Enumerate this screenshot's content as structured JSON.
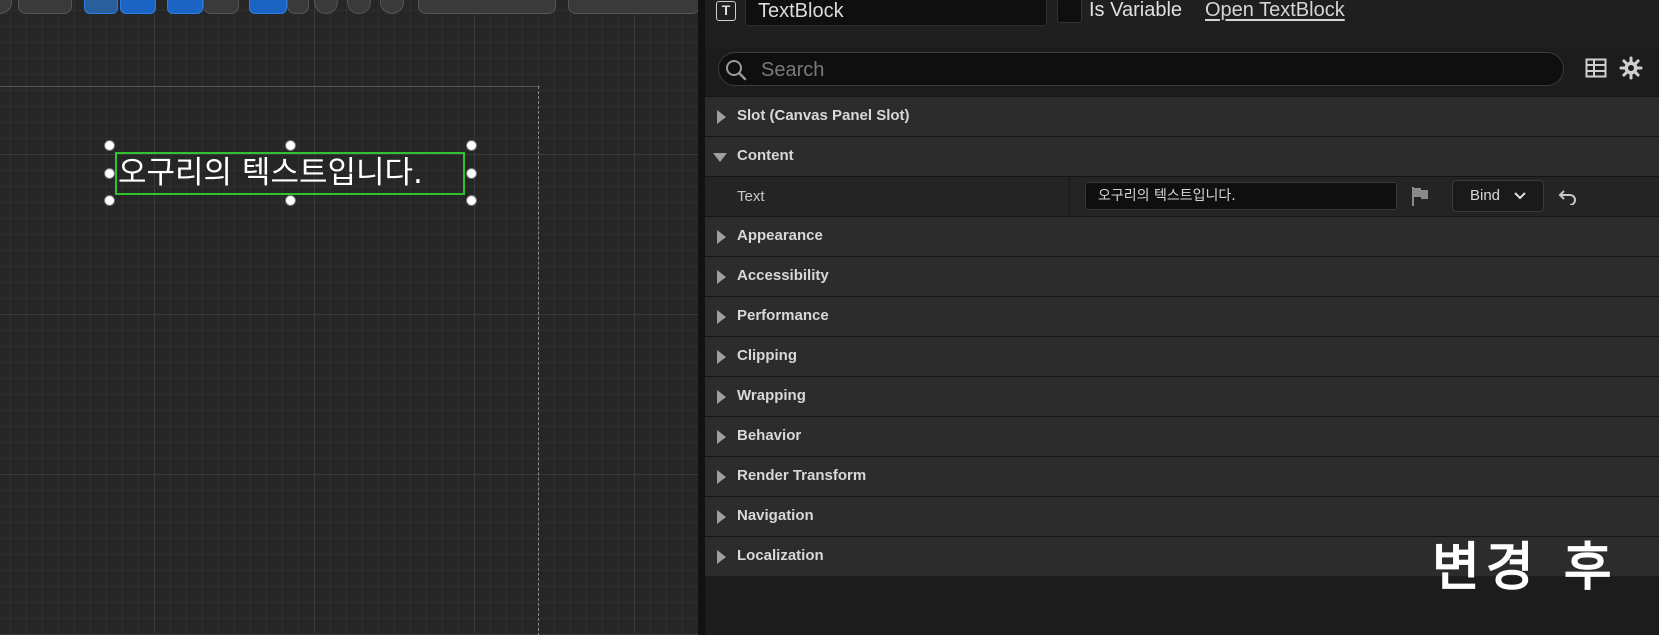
{
  "canvas": {
    "widget_text": "오구리의 텍스트입니다."
  },
  "details": {
    "widget_name": "TextBlock",
    "is_variable_label": "Is Variable",
    "is_variable_checked": false,
    "open_link": "Open TextBlock",
    "search_placeholder": "Search",
    "categories": [
      {
        "label": "Slot (Canvas Panel Slot)",
        "expanded": false
      },
      {
        "label": "Content",
        "expanded": true
      },
      {
        "label": "Appearance",
        "expanded": false
      },
      {
        "label": "Accessibility",
        "expanded": false
      },
      {
        "label": "Performance",
        "expanded": false
      },
      {
        "label": "Clipping",
        "expanded": false
      },
      {
        "label": "Wrapping",
        "expanded": false
      },
      {
        "label": "Behavior",
        "expanded": false
      },
      {
        "label": "Render Transform",
        "expanded": false
      },
      {
        "label": "Navigation",
        "expanded": false
      },
      {
        "label": "Localization",
        "expanded": false
      }
    ],
    "text_property": {
      "label": "Text",
      "value": "오구리의 텍스트입니다.",
      "bind_label": "Bind"
    }
  },
  "overlay_caption": "변경 후",
  "icons": [
    "text-block-icon",
    "search-icon",
    "table-view-icon",
    "gear-icon",
    "flag-icon",
    "chevron-down-icon",
    "reset-arrow-icon"
  ],
  "colors": {
    "selection_outline": "#31c231",
    "toolbar_active": "#1b64c4"
  }
}
